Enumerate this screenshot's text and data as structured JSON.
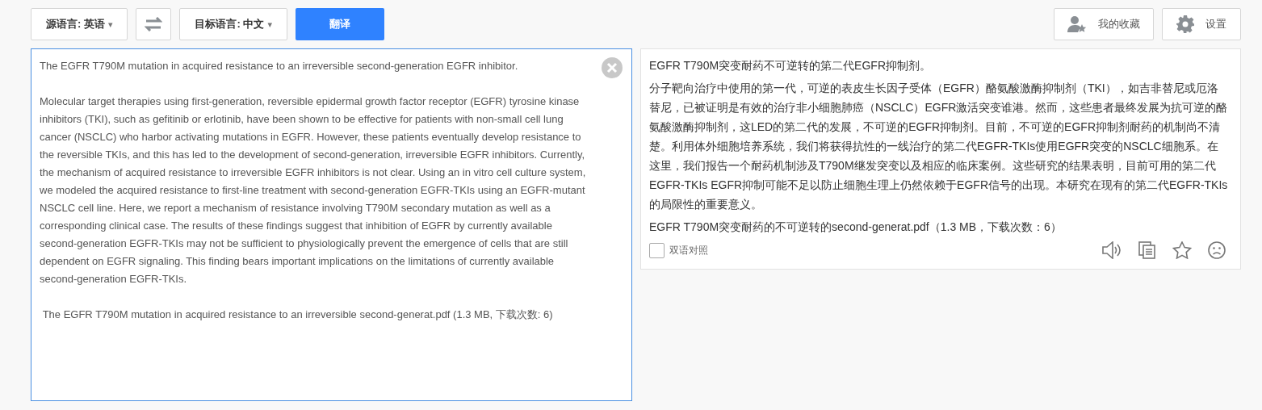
{
  "toolbar": {
    "source_language": {
      "label": "源语言: 英语",
      "caret": "▾"
    },
    "target_language": {
      "label": "目标语言: 中文",
      "caret": "▾"
    },
    "translate_button": "翻译",
    "favorites_button": "我的收藏",
    "settings_button": "设置"
  },
  "source": {
    "paragraphs": [
      "The EGFR T790M mutation in acquired resistance to an irreversible second-generation EGFR inhibitor.",
      "Molecular target therapies using first-generation, reversible epidermal growth factor receptor (EGFR) tyrosine kinase inhibitors (TKI), such as gefitinib or erlotinib, have been shown to be effective for patients with non-small cell lung cancer (NSCLC) who harbor activating mutations in EGFR. However, these patients eventually develop resistance to the reversible TKIs, and this has led to the development of second-generation, irreversible EGFR inhibitors. Currently, the mechanism of acquired resistance to irreversible EGFR inhibitors is not clear. Using an in vitro cell culture system, we modeled the acquired resistance to first-line treatment with second-generation EGFR-TKIs using an EGFR-mutant NSCLC cell line. Here, we report a mechanism of resistance involving T790M secondary mutation as well as a corresponding clinical case. The results of these findings suggest that inhibition of EGFR by currently available second-generation EGFR-TKIs may not be sufficient to physiologically prevent the emergence of cells that are still dependent on EGFR signaling. This finding bears important implications on the limitations of currently available second-generation EGFR-TKIs.",
      " The EGFR T790M mutation in acquired resistance to an irreversible second-generat.pdf (1.3 MB, 下载次数: 6)"
    ]
  },
  "result": {
    "paragraphs": [
      "EGFR T790M突变耐药不可逆转的第二代EGFR抑制剂。",
      "分子靶向治疗中使用的第一代，可逆的表皮生长因子受体（EGFR）酪氨酸激酶抑制剂（TKI），如吉非替尼或厄洛替尼，已被证明是有效的治疗非小细胞肺癌（NSCLC）EGFR激活突变谁港。然而，这些患者最终发展为抗可逆的酪氨酸激酶抑制剂，这LED的第二代的发展，不可逆的EGFR抑制剂。目前，不可逆的EGFR抑制剂耐药的机制尚不清楚。利用体外细胞培养系统，我们将获得抗性的一线治疗的第二代EGFR-TKIs使用EGFR突变的NSCLC细胞系。在这里，我们报告一个耐药机制涉及T790M继发突变以及相应的临床案例。这些研究的结果表明，目前可用的第二代EGFR-TKIs EGFR抑制可能不足以防止细胞生理上仍然依赖于EGFR信号的出现。本研究在现有的第二代EGFR-TKIs的局限性的重要意义。",
      "EGFR T790M突变耐药的不可逆转的second-generat.pdf（1.3 MB，下载次数：6）"
    ],
    "bilingual": {
      "label": "双语对照",
      "checked": false
    }
  }
}
